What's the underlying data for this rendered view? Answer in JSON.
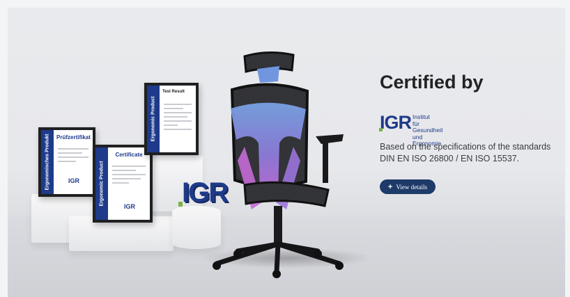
{
  "banner": {
    "headline": "Certified by",
    "institute": {
      "logo_text": "IGR",
      "name_lines": [
        "Institut",
        "für Gesundheit",
        "und Ergonomie"
      ]
    },
    "description": "Based on the specifications of the standards DIN EN ISO 26800 / EN ISO 15537.",
    "cta_label": "View details",
    "cta_icon": "plus-icon",
    "brand_color": "#1e3a8a",
    "button_color": "#1e3a68"
  },
  "certificates": [
    {
      "side_label": "Ergonomisches Produkt",
      "title": "Prüfzertifikat"
    },
    {
      "side_label": "Ergonomic Product",
      "title": "Certificate"
    },
    {
      "side_label": "Ergonomic Product",
      "title": "Test Result"
    }
  ],
  "display_logo": "IGR"
}
